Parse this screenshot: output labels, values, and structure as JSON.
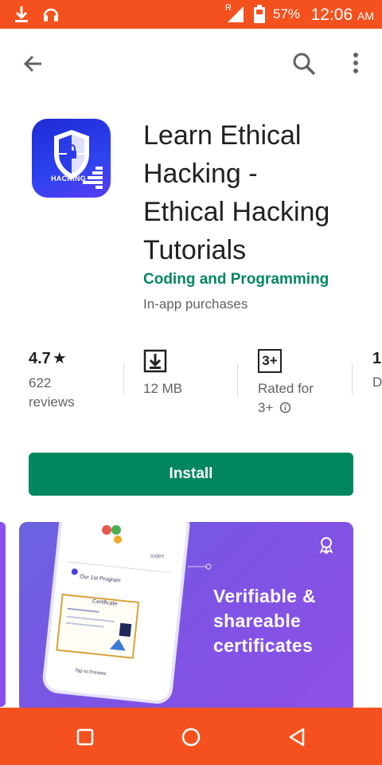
{
  "status_bar": {
    "network_label": "R",
    "battery": "57%",
    "time": "12:06",
    "ampm": "AM"
  },
  "app": {
    "title_lines": [
      "Learn Ethical",
      "Hacking -",
      "Ethical Hacking",
      "Tutorials"
    ],
    "icon_text": "HACKING",
    "developer": "Coding and Programming",
    "in_app": "In-app purchases"
  },
  "stats": {
    "rating": "4.7",
    "rating_star": "★",
    "reviews_count": "622",
    "reviews_label": "reviews",
    "size": "12 MB",
    "content_rating_badge": "3+",
    "rated_for": "Rated for",
    "rated_value": "3+",
    "downloads_partial": "1(",
    "downloads_partial_label": "D"
  },
  "install_label": "Install",
  "screenshot": {
    "caption_lines": [
      "Verifiable &",
      "shareable",
      "certificates"
    ],
    "mock_program": "Our 1st Program",
    "mock_index": "Index",
    "mock_certificate": "Certificate",
    "mock_tap": "Tap to Preview"
  },
  "colors": {
    "status_bar": "#f4511e",
    "accent_green": "#01875f",
    "icon_blue": "#1d2bd6"
  }
}
